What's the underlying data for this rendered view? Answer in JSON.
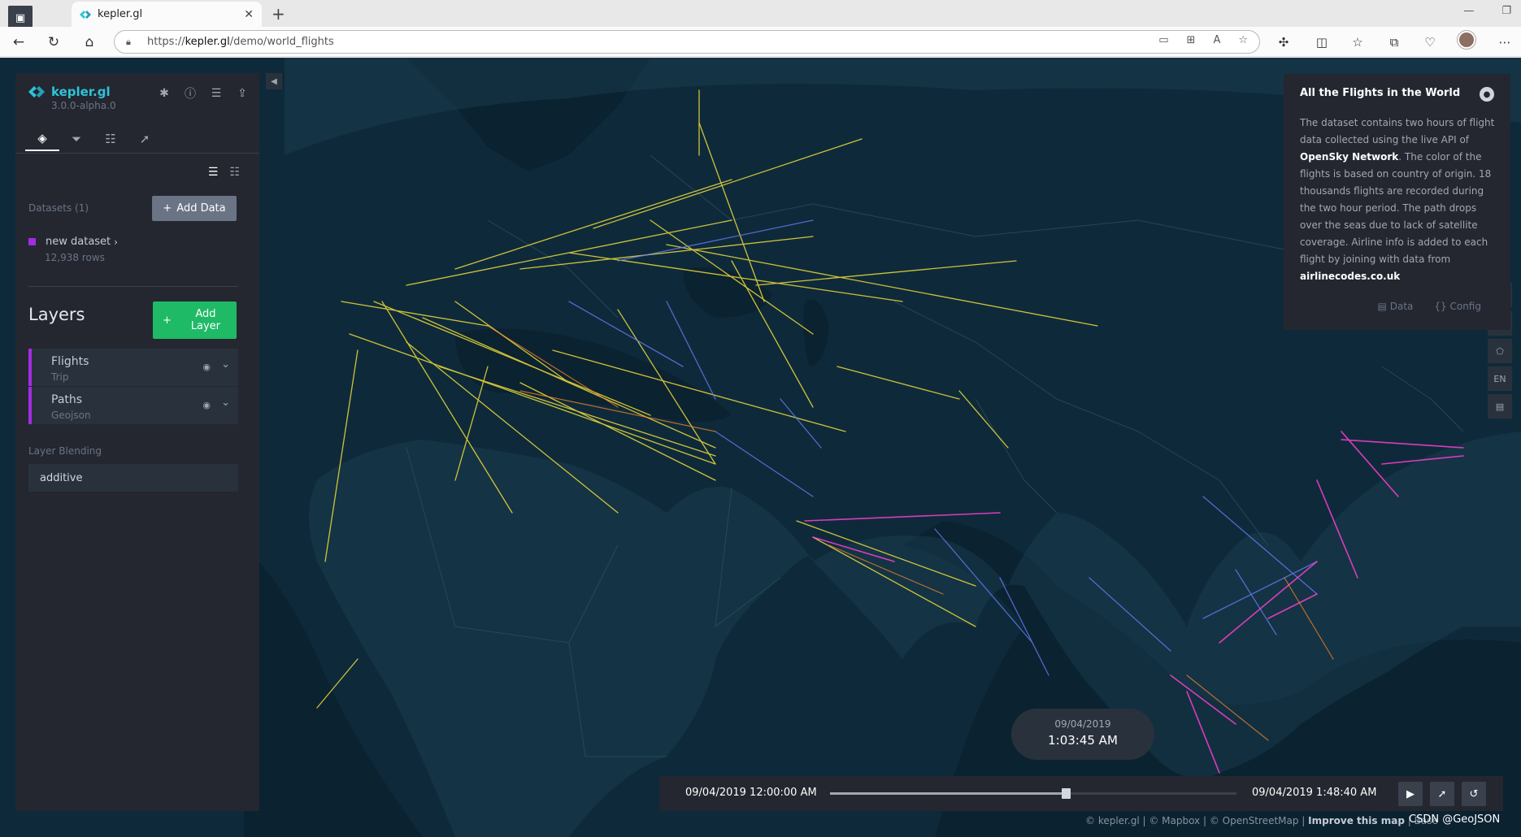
{
  "browser": {
    "tab_title": "kepler.gl",
    "url_prefix": "https://",
    "url_host": "kepler.gl",
    "url_path": "/demo/world_flights"
  },
  "app": {
    "brand_name": "kepler.gl",
    "version": "3.0.0-alpha.0"
  },
  "datasets": {
    "label": "Datasets (1)",
    "add_button": "Add Data",
    "items": [
      {
        "name": "new dataset",
        "rows": "12,938 rows",
        "color": "#a22de0"
      }
    ]
  },
  "layers": {
    "title": "Layers",
    "add_button": "Add Layer",
    "items": [
      {
        "name": "Flights",
        "type": "Trip",
        "color": "#a22de0"
      },
      {
        "name": "Paths",
        "type": "Geojson",
        "color": "#a22de0"
      }
    ],
    "blending_label": "Layer Blending",
    "blending_value": "additive"
  },
  "info": {
    "title": "All the Flights in the World",
    "body_1": "The dataset contains two hours of flight data collected using the live API of",
    "body_link_1": "OpenSky Network",
    "body_2": ". The color of the flights is based on country of origin. 18 thousands flights are recorded during the two hour period. The path drops over the seas due to lack of satellite coverage. Airline info is added to each flight by joining with data from",
    "body_link_2": "airlinecodes.co.uk",
    "data_link": "Data",
    "config_link": "Config"
  },
  "map_controls": {
    "locale": "EN"
  },
  "time": {
    "current_date": "09/04/2019",
    "current_time": "1:03:45 AM",
    "start": "09/04/2019 12:00:00 AM",
    "end": "09/04/2019 1:48:40 AM",
    "progress": 0.58
  },
  "attribution": {
    "part1": "© kepler.gl | © Mapbox | © OpenStreetMap |",
    "improve": "Improve this map",
    "part2": "| Base"
  },
  "watermark": "CSDN @GeoJSON"
}
